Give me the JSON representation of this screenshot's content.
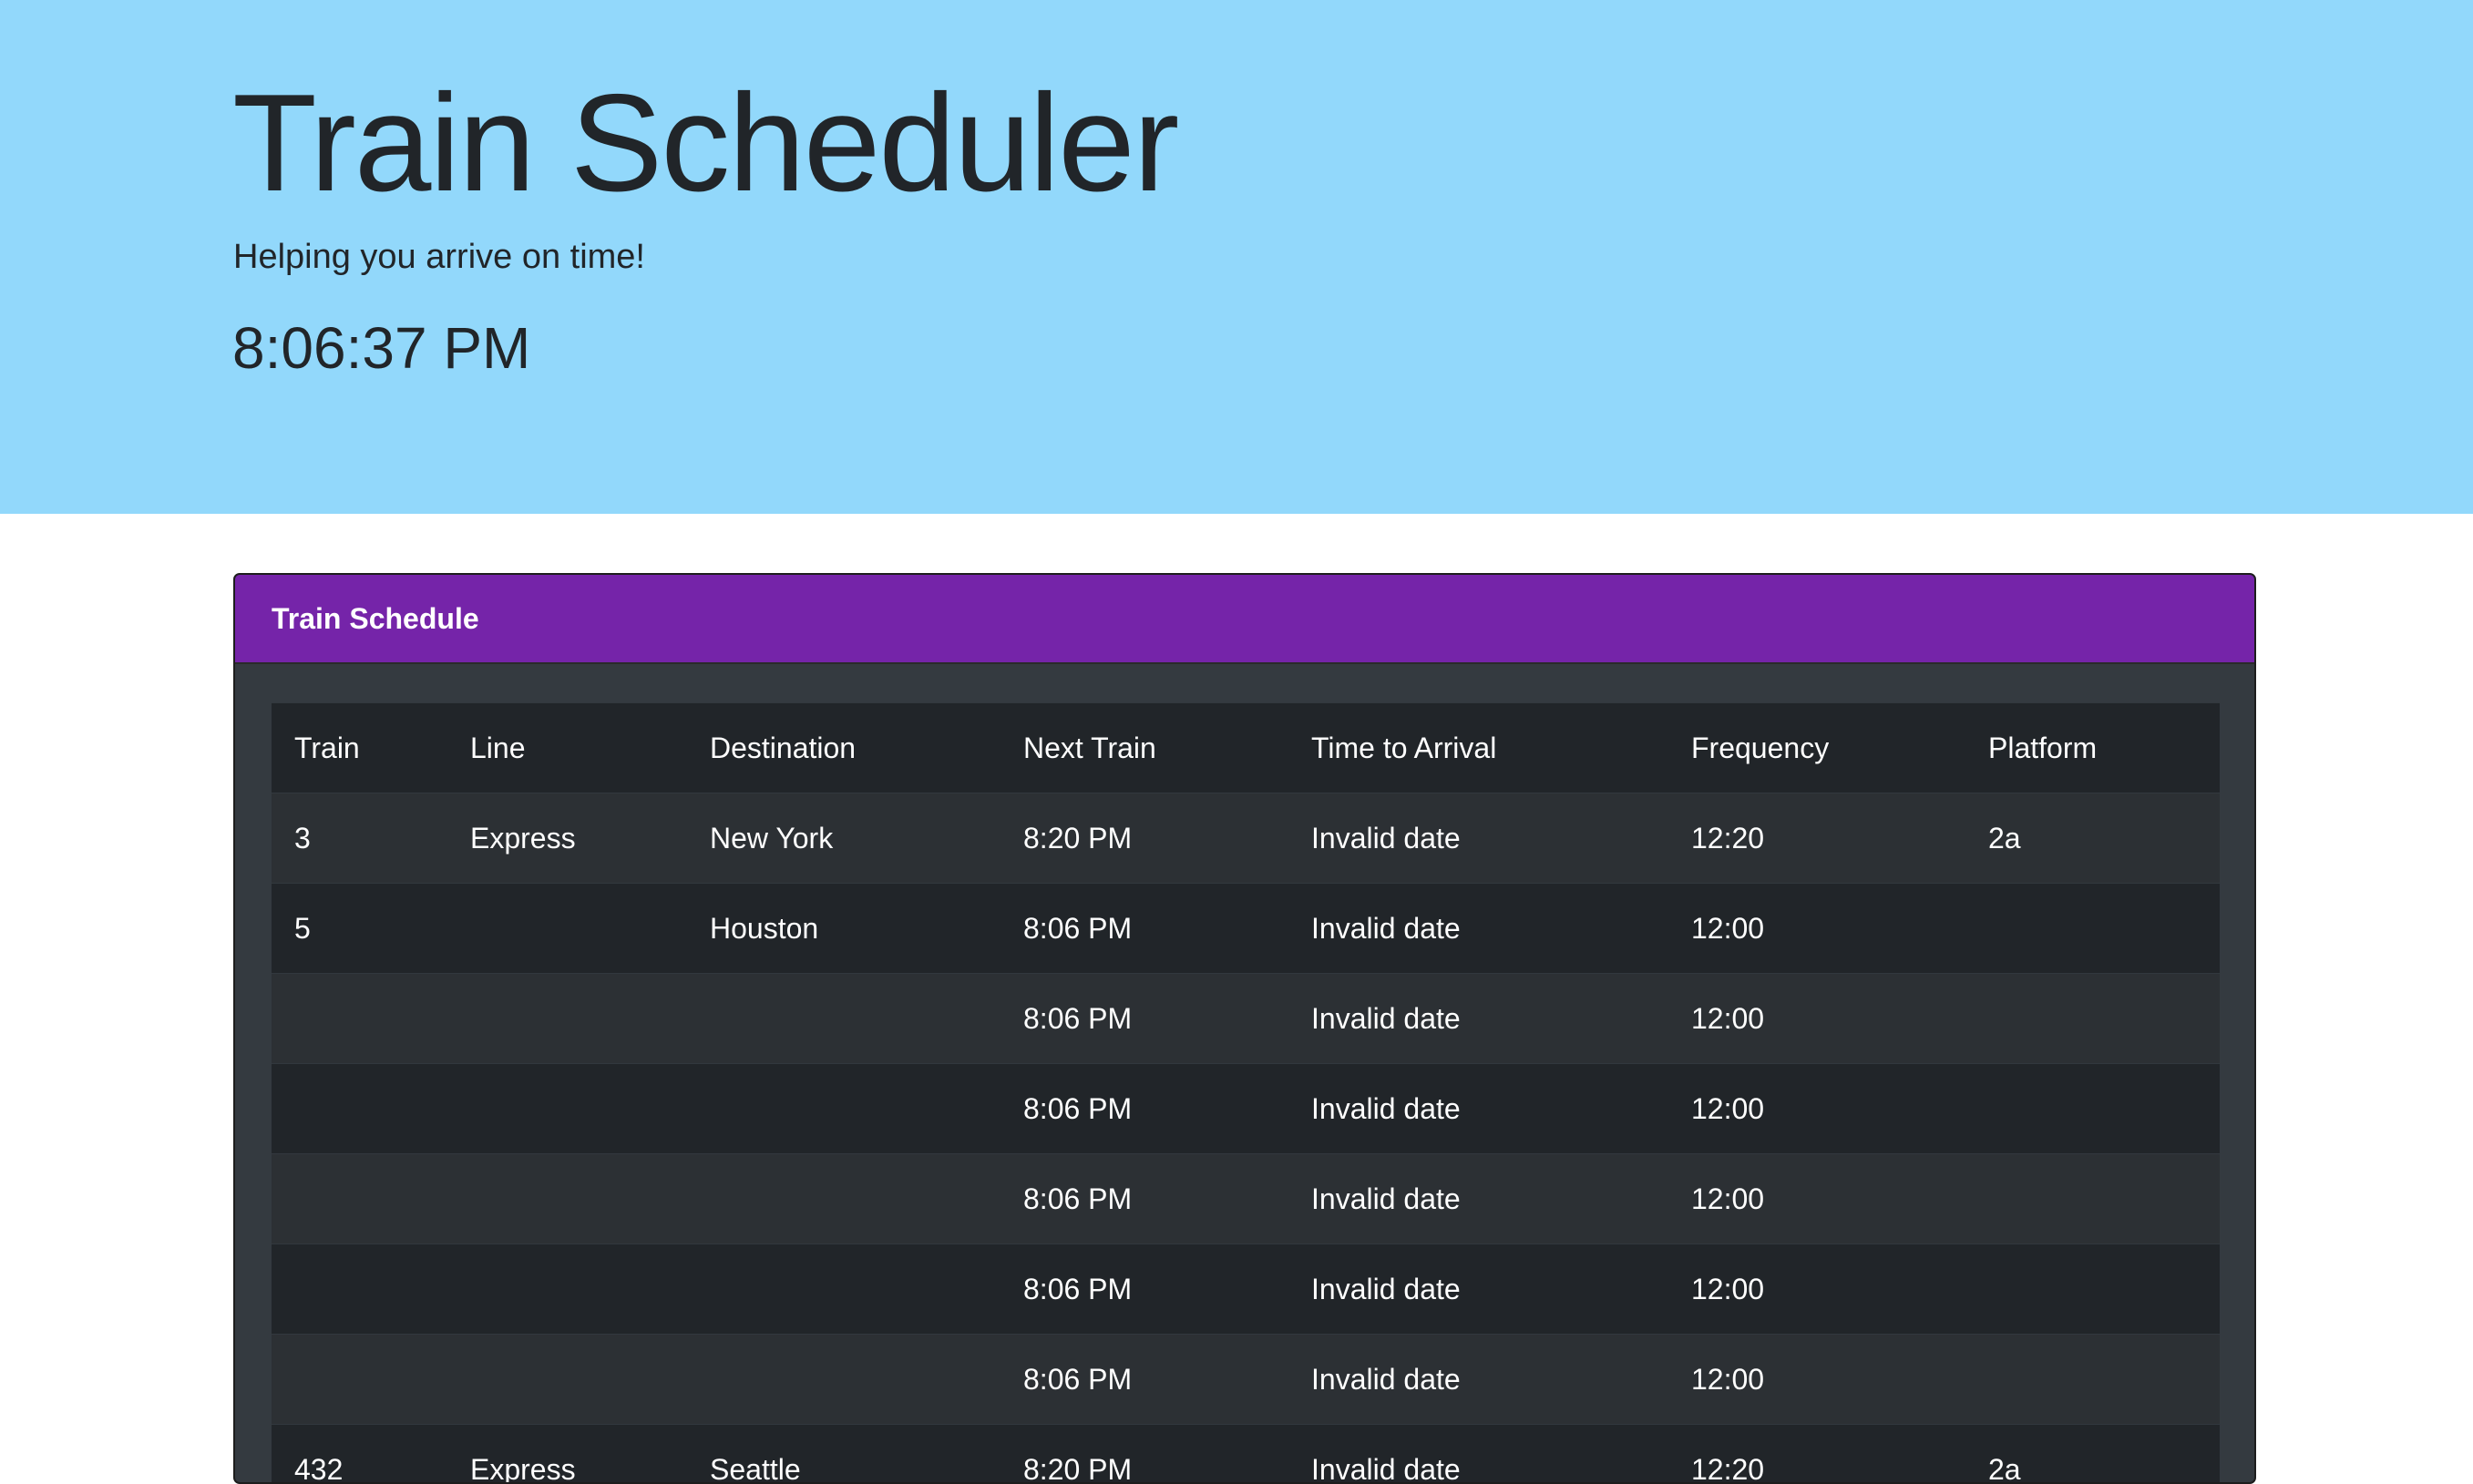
{
  "header": {
    "title": "Train Scheduler",
    "tagline": "Helping you arrive on time!",
    "current_time": "8:06:37 PM",
    "background_color": "#92d8fb"
  },
  "schedule": {
    "title": "Train Schedule",
    "header_color": "#7524a9",
    "columns": [
      "Train",
      "Line",
      "Destination",
      "Next Train",
      "Time to Arrival",
      "Frequency",
      "Platform"
    ],
    "rows": [
      [
        "3",
        "Express",
        "New York",
        "8:20 PM",
        "Invalid date",
        "12:20",
        "2a"
      ],
      [
        "5",
        "",
        "Houston",
        "8:06 PM",
        "Invalid date",
        "12:00",
        ""
      ],
      [
        "",
        "",
        "",
        "8:06 PM",
        "Invalid date",
        "12:00",
        ""
      ],
      [
        "",
        "",
        "",
        "8:06 PM",
        "Invalid date",
        "12:00",
        ""
      ],
      [
        "",
        "",
        "",
        "8:06 PM",
        "Invalid date",
        "12:00",
        ""
      ],
      [
        "",
        "",
        "",
        "8:06 PM",
        "Invalid date",
        "12:00",
        ""
      ],
      [
        "",
        "",
        "",
        "8:06 PM",
        "Invalid date",
        "12:00",
        ""
      ],
      [
        "432",
        "Express",
        "Seattle",
        "8:20 PM",
        "Invalid date",
        "12:20",
        "2a"
      ]
    ]
  }
}
